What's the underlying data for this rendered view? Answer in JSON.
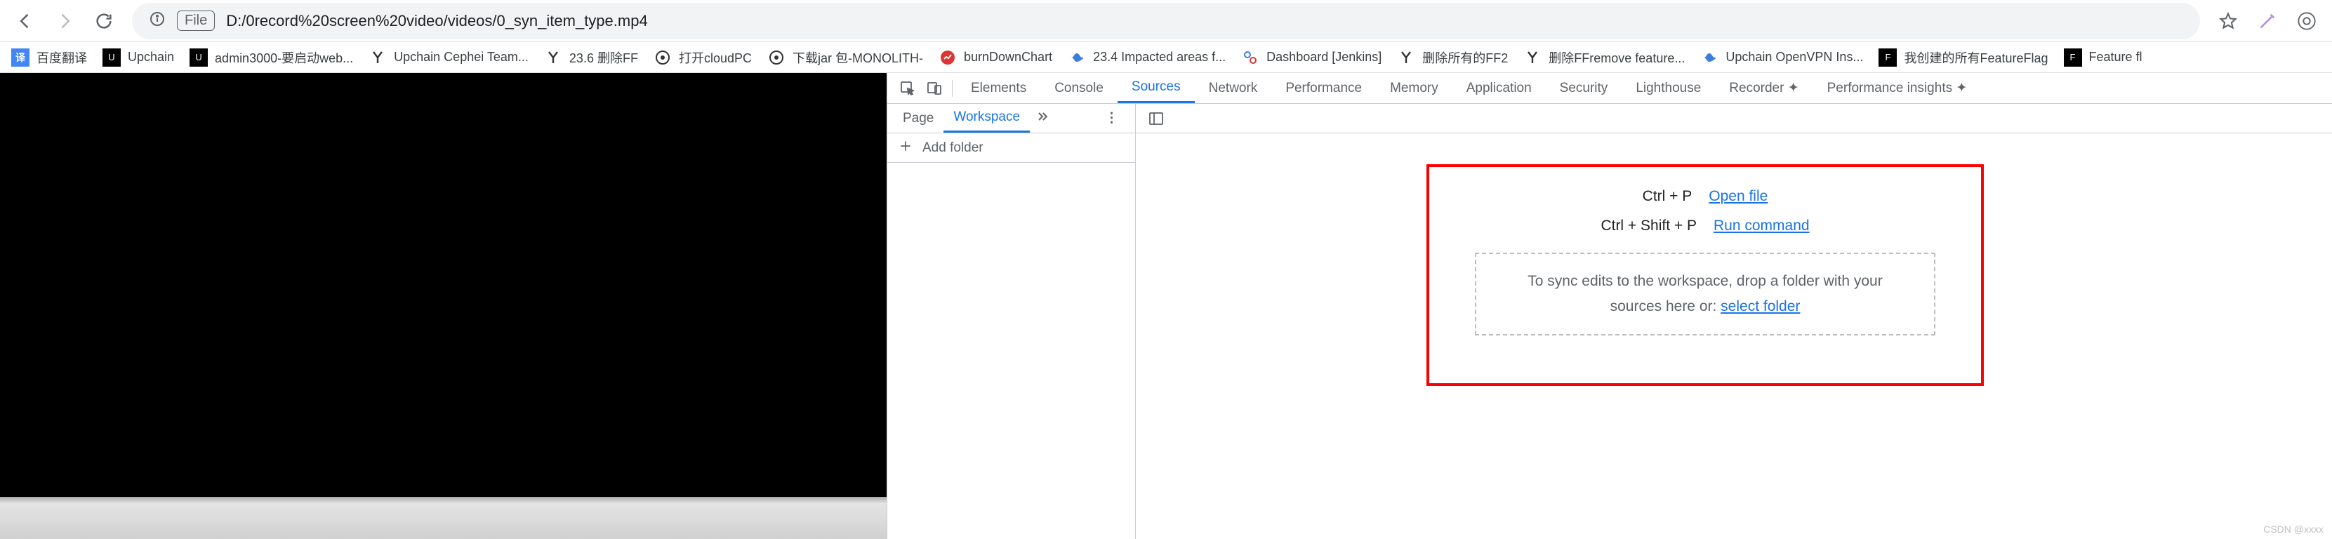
{
  "nav": {
    "file_badge": "File",
    "url": "D:/0record%20screen%20video/videos/0_syn_item_type.mp4"
  },
  "bookmarks": [
    {
      "icon": "blue",
      "icon_text": "译",
      "label": "百度翻译"
    },
    {
      "icon": "black",
      "icon_text": "U",
      "label": "Upchain"
    },
    {
      "icon": "black",
      "icon_text": "U",
      "label": "admin3000-要启动web..."
    },
    {
      "icon": "y",
      "label": "Upchain Cephei Team..."
    },
    {
      "icon": "y",
      "label": "23.6 删除FF"
    },
    {
      "icon": "circle",
      "label": "打开cloudPC"
    },
    {
      "icon": "circle",
      "label": "下载jar 包-MONOLITH-"
    },
    {
      "icon": "chart",
      "label": "burnDownChart"
    },
    {
      "icon": "split",
      "label": "23.4 Impacted areas f..."
    },
    {
      "icon": "link",
      "label": "Dashboard [Jenkins]"
    },
    {
      "icon": "y",
      "label": "删除所有的FF2"
    },
    {
      "icon": "y",
      "label": "删除FFremove feature..."
    },
    {
      "icon": "split",
      "label": "Upchain OpenVPN Ins..."
    },
    {
      "icon": "black",
      "icon_text": "F",
      "label": "我创建的所有FeatureFlag"
    },
    {
      "icon": "black",
      "icon_text": "F",
      "label": "Feature fl"
    }
  ],
  "devtools": {
    "tabs": [
      "Elements",
      "Console",
      "Sources",
      "Network",
      "Performance",
      "Memory",
      "Application",
      "Security",
      "Lighthouse",
      "Recorder",
      "Performance insights"
    ],
    "active_tab": "Sources",
    "recorder_suffix": "⚡",
    "insights_suffix": "⚡",
    "subtabs": {
      "page": "Page",
      "workspace": "Workspace"
    },
    "active_subtab": "Workspace",
    "add_folder": "Add folder",
    "hints": {
      "open_key": "Ctrl + P",
      "open_link": "Open file",
      "run_key": "Ctrl + Shift + P",
      "run_link": "Run command",
      "drop_text_pre": "To sync edits to the workspace, drop a folder with your sources here or: ",
      "select_folder": "select folder"
    }
  },
  "watermark": "CSDN @xxxx"
}
